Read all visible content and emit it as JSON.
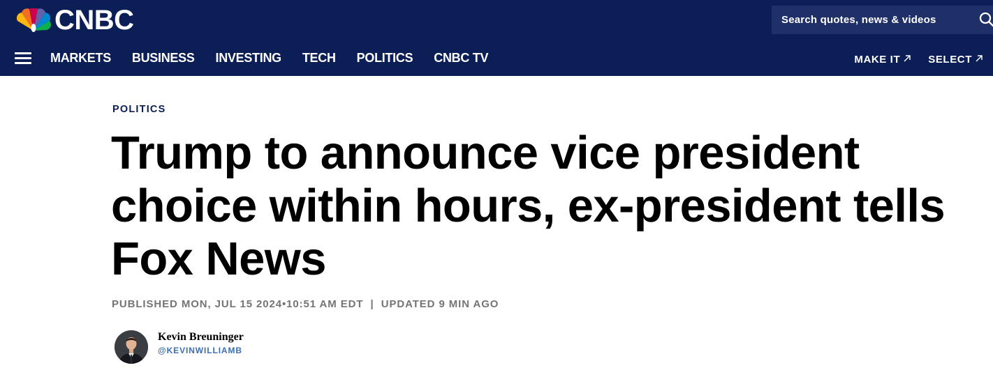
{
  "header": {
    "logo_text": "CNBC",
    "logo_icon": "peacock-icon",
    "search": {
      "placeholder": "Search quotes, news & videos",
      "icon": "search-icon"
    },
    "nav": {
      "menu_icon": "hamburger-menu-icon",
      "items": [
        {
          "label": "MARKETS"
        },
        {
          "label": "BUSINESS"
        },
        {
          "label": "INVESTING"
        },
        {
          "label": "TECH"
        },
        {
          "label": "POLITICS"
        },
        {
          "label": "CNBC TV"
        }
      ],
      "external_links": [
        {
          "label": "MAKE IT",
          "icon": "external-arrow-icon"
        },
        {
          "label": "SELECT",
          "icon": "external-arrow-icon"
        }
      ]
    }
  },
  "article": {
    "section": "POLITICS",
    "headline": "Trump to announce vice president choice within hours, ex-president tells Fox News",
    "published": "PUBLISHED MON, JUL 15 2024•10:51 AM EDT",
    "separator": "|",
    "updated": "UPDATED 9 MIN AGO",
    "author": {
      "name": "Kevin Breuninger",
      "handle": "@KEVINWILLIAMB"
    }
  },
  "colors": {
    "header_bg": "#0c1e56",
    "search_bg": "#1f2f68",
    "section_label": "#0c1e56",
    "timestamp": "#747474",
    "author_handle": "#3c6fb0"
  }
}
